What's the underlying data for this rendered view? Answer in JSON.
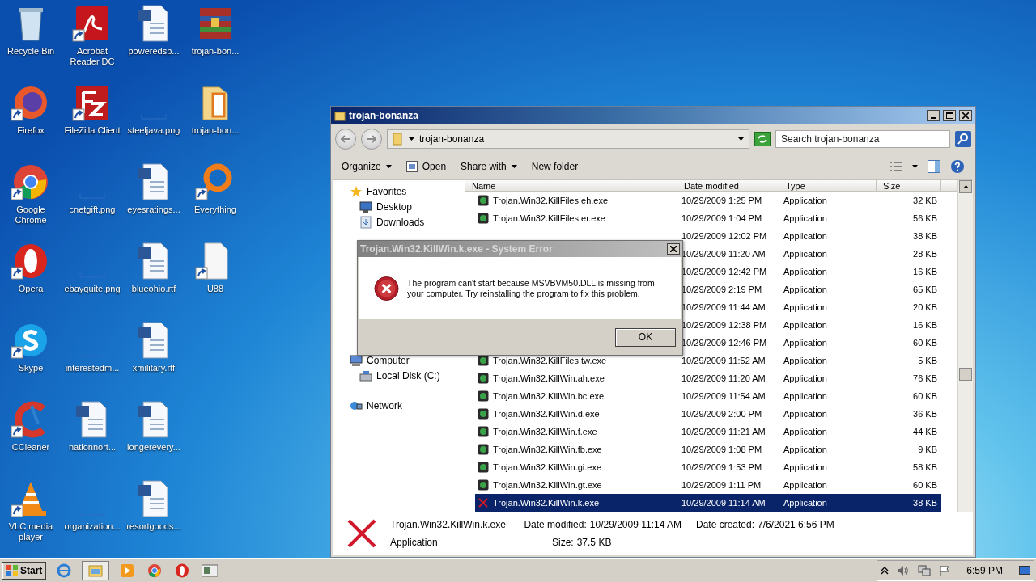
{
  "desktop": {
    "icons": [
      {
        "label": "Recycle Bin",
        "kind": "recycle",
        "shortcut": false
      },
      {
        "label": "Firefox",
        "kind": "firefox",
        "shortcut": true
      },
      {
        "label": "Google Chrome",
        "kind": "chrome",
        "shortcut": true
      },
      {
        "label": "Opera",
        "kind": "opera",
        "shortcut": true
      },
      {
        "label": "Skype",
        "kind": "skype",
        "shortcut": true
      },
      {
        "label": "CCleaner",
        "kind": "ccleaner",
        "shortcut": true
      },
      {
        "label": "VLC media player",
        "kind": "vlc",
        "shortcut": true
      },
      {
        "label": "Acrobat Reader DC",
        "kind": "pdf",
        "shortcut": true
      },
      {
        "label": "FileZilla Client",
        "kind": "filezilla",
        "shortcut": true
      },
      {
        "label": "cnetgift.png",
        "kind": "image"
      },
      {
        "label": "ebayquite.png",
        "kind": "image"
      },
      {
        "label": "interestedm...",
        "kind": "image"
      },
      {
        "label": "nationnort...",
        "kind": "word",
        "shortcut": false
      },
      {
        "label": "organization...",
        "kind": "image"
      },
      {
        "label": "poweredsp...",
        "kind": "word",
        "shortcut": false
      },
      {
        "label": "steeljava.png",
        "kind": "image"
      },
      {
        "label": "eyesratings...",
        "kind": "word",
        "shortcut": false
      },
      {
        "label": "blueohio.rtf",
        "kind": "word",
        "shortcut": false
      },
      {
        "label": "xmilitary.rtf",
        "kind": "word",
        "shortcut": false
      },
      {
        "label": "longerevery...",
        "kind": "word",
        "shortcut": false
      },
      {
        "label": "resortgoods...",
        "kind": "word",
        "shortcut": false
      },
      {
        "label": "trojan-bon...",
        "kind": "archive",
        "shortcut": false
      },
      {
        "label": "trojan-bon...",
        "kind": "folder",
        "shortcut": false
      },
      {
        "label": "Everything",
        "kind": "everything",
        "shortcut": true
      },
      {
        "label": "U88",
        "kind": "file",
        "shortcut": true
      }
    ]
  },
  "explorer": {
    "title": "trojan-bonanza",
    "address": "trojan-bonanza",
    "search": {
      "placeholder": "Search trojan-bonanza"
    },
    "commands": [
      {
        "label": "Organize",
        "kind": "menu"
      },
      {
        "label": "Open",
        "kind": "open"
      },
      {
        "label": "Share with",
        "kind": "menu"
      },
      {
        "label": "New folder",
        "kind": "plain"
      }
    ],
    "nav": [
      {
        "label": "Favorites",
        "kind": "favorites",
        "children": [
          {
            "label": "Desktop",
            "kind": "desktop"
          },
          {
            "label": "Downloads",
            "kind": "downloads"
          }
        ]
      },
      {
        "label": "Computer",
        "kind": "computer",
        "children": [
          {
            "label": "Local Disk (C:)",
            "kind": "disk"
          }
        ]
      },
      {
        "label": "Network",
        "kind": "network"
      }
    ],
    "columns": [
      "Name",
      "Date modified",
      "Type",
      "Size"
    ],
    "rows": [
      {
        "name": "Trojan.Win32.KillFiles.eh.exe",
        "date": "10/29/2009 1:25 PM",
        "type": "Application",
        "size": "32 KB",
        "selected": false
      },
      {
        "name": "Trojan.Win32.KillFiles.er.exe",
        "date": "10/29/2009 1:04 PM",
        "type": "Application",
        "size": "56 KB",
        "selected": false
      },
      {
        "date": "10/29/2009 12:02 PM",
        "type": "Application",
        "size": "38 KB",
        "selected": false
      },
      {
        "date": "10/29/2009 11:20 AM",
        "type": "Application",
        "size": "28 KB",
        "selected": false
      },
      {
        "date": "10/29/2009 12:42 PM",
        "type": "Application",
        "size": "16 KB",
        "selected": false
      },
      {
        "date": "10/29/2009 2:19 PM",
        "type": "Application",
        "size": "65 KB",
        "selected": false
      },
      {
        "date": "10/29/2009 11:44 AM",
        "type": "Application",
        "size": "20 KB",
        "selected": false
      },
      {
        "date": "10/29/2009 12:38 PM",
        "type": "Application",
        "size": "16 KB",
        "selected": false
      },
      {
        "date": "10/29/2009 12:46 PM",
        "type": "Application",
        "size": "60 KB",
        "selected": false
      },
      {
        "name": "Trojan.Win32.KillFiles.tw.exe",
        "date": "10/29/2009 11:52 AM",
        "type": "Application",
        "size": "5 KB",
        "selected": false
      },
      {
        "name": "Trojan.Win32.KillWin.ah.exe",
        "date": "10/29/2009 11:20 AM",
        "type": "Application",
        "size": "76 KB",
        "selected": false
      },
      {
        "name": "Trojan.Win32.KillWin.bc.exe",
        "date": "10/29/2009 11:54 AM",
        "type": "Application",
        "size": "60 KB",
        "selected": false
      },
      {
        "name": "Trojan.Win32.KillWin.d.exe",
        "date": "10/29/2009 2:00 PM",
        "type": "Application",
        "size": "36 KB",
        "selected": false
      },
      {
        "name": "Trojan.Win32.KillWin.f.exe",
        "date": "10/29/2009 11:21 AM",
        "type": "Application",
        "size": "44 KB",
        "selected": false
      },
      {
        "name": "Trojan.Win32.KillWin.fb.exe",
        "date": "10/29/2009 1:08 PM",
        "type": "Application",
        "size": "9 KB",
        "selected": false
      },
      {
        "name": "Trojan.Win32.KillWin.gi.exe",
        "date": "10/29/2009 1:53 PM",
        "type": "Application",
        "size": "58 KB",
        "selected": false
      },
      {
        "name": "Trojan.Win32.KillWin.gt.exe",
        "date": "10/29/2009 1:11 PM",
        "type": "Application",
        "size": "60 KB",
        "selected": false
      },
      {
        "name": "Trojan.Win32.KillWin.k.exe",
        "date": "10/29/2009 11:14 AM",
        "type": "Application",
        "size": "38 KB",
        "selected": true
      }
    ],
    "details": {
      "name": "Trojan.Win32.KillWin.k.exe",
      "type": "Application",
      "modified_label": "Date modified:",
      "modified": "10/29/2009 11:14 AM",
      "size_label": "Size:",
      "size": "37.5 KB",
      "created_label": "Date created:",
      "created": "7/6/2021 6:56 PM"
    }
  },
  "dialog": {
    "title": "Trojan.Win32.KillWin.k.exe - System Error",
    "message": "The program can't start because MSVBVM50.DLL is missing from your computer. Try reinstalling the program to fix this problem.",
    "button": "OK"
  },
  "taskbar": {
    "start": "Start",
    "items": [
      {
        "kind": "ie",
        "selected": false
      },
      {
        "kind": "explorer",
        "selected": true
      },
      {
        "kind": "media",
        "selected": false
      },
      {
        "kind": "chrome",
        "selected": false
      },
      {
        "kind": "opera",
        "selected": false
      },
      {
        "kind": "window",
        "selected": false
      }
    ],
    "time": "6:59 PM"
  }
}
